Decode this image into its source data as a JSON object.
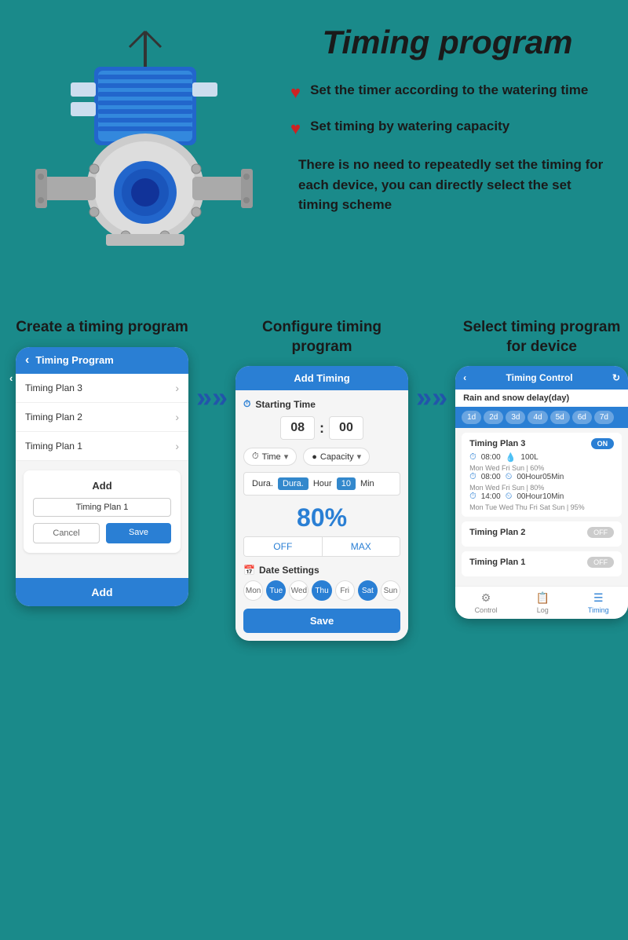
{
  "page": {
    "title": "Timing program",
    "background_color": "#1a8a8a"
  },
  "header": {
    "title": "Timing program",
    "feature1": "Set the timer according to the watering time",
    "feature2": "Set timing by watering capacity",
    "description": "There is no need to repeatedly set the timing for each device, you can directly select the set timing scheme"
  },
  "step1": {
    "title": "Create a timing program",
    "phone": {
      "header": "Timing Program",
      "item1": "Timing Plan 3",
      "item2": "Timing Plan 2",
      "item3": "Timing Plan 1",
      "add_label": "Add",
      "input_placeholder": "Timing Plan 1",
      "cancel": "Cancel",
      "save": "Save",
      "footer_add": "Add"
    }
  },
  "step2": {
    "title": "Configure timing program",
    "phone": {
      "header": "Add Timing",
      "starting_time_label": "Starting Time",
      "hour": "08",
      "minute": "00",
      "time_label": "Time",
      "capacity_label": "Capacity",
      "dura_label": "Dura.",
      "hour_label": "Hour",
      "num": "10",
      "min_label": "Min",
      "percent": "80%",
      "off": "OFF",
      "max": "MAX",
      "date_settings": "Date Settings",
      "days": [
        "Mon",
        "Tue",
        "Wed",
        "Thu",
        "Fri",
        "Sat",
        "Sun"
      ],
      "active_days": [
        "Tue",
        "Thu",
        "Sat"
      ],
      "save": "Save"
    }
  },
  "step3": {
    "title": "Select timing program for device",
    "phone": {
      "header": "Timing Control",
      "delay_label": "Rain and snow delay(day)",
      "day_chips": [
        "1d",
        "2d",
        "3d",
        "4d",
        "5d",
        "6d",
        "7d"
      ],
      "plan3_name": "Timing Plan 3",
      "plan3_toggle": "ON",
      "plan3_entry1_time": "08:00",
      "plan3_entry1_val": "100L",
      "plan3_entry1_days": "Mon  Wed  Fri  Sun | 60%",
      "plan3_entry2_time": "08:00",
      "plan3_entry2_val": "00Hour05Min",
      "plan3_entry2_days": "Mon  Wed  Fri  Sun | 80%",
      "plan3_entry3_time": "14:00",
      "plan3_entry3_val": "00Hour10Min",
      "plan3_entry3_days": "Mon  Tue  Wed  Thu  Fri  Sat  Sun | 95%",
      "plan2_name": "Timing Plan 2",
      "plan2_toggle": "OFF",
      "plan1_name": "Timing Plan 1",
      "plan1_toggle": "OFF",
      "footer_control": "Control",
      "footer_log": "Log",
      "footer_timing": "Timing"
    }
  },
  "arrows": {
    "symbol": "»»"
  }
}
